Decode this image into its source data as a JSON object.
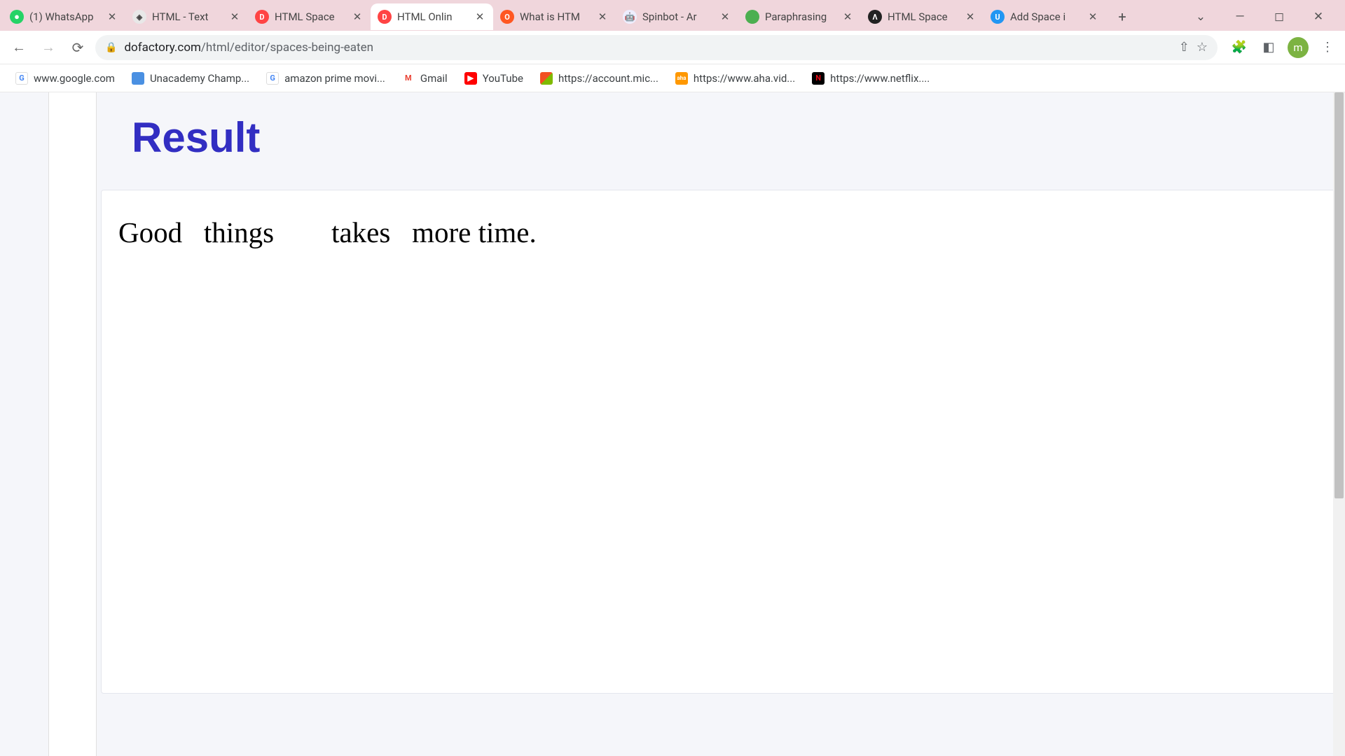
{
  "tabs": [
    {
      "title": "(1) WhatsApp",
      "favicon_bg": "#25d366",
      "favicon_text": "",
      "active": false
    },
    {
      "title": "HTML - Text",
      "favicon_bg": "#4a4a4a",
      "favicon_text": "◆",
      "active": false
    },
    {
      "title": "HTML Space",
      "favicon_bg": "#ff4444",
      "favicon_text": "D",
      "active": false
    },
    {
      "title": "HTML Onlin",
      "favicon_bg": "#ff4444",
      "favicon_text": "D",
      "active": true
    },
    {
      "title": "What is HTM",
      "favicon_bg": "#ff5722",
      "favicon_text": "O",
      "active": false
    },
    {
      "title": "Spinbot - Ar",
      "favicon_bg": "#5c6bc0",
      "favicon_text": "🤖",
      "active": false
    },
    {
      "title": "Paraphrasing",
      "favicon_bg": "#4caf50",
      "favicon_text": "",
      "active": false
    },
    {
      "title": "HTML Space",
      "favicon_bg": "#222222",
      "favicon_text": "Λ",
      "active": false
    },
    {
      "title": "Add Space i",
      "favicon_bg": "#2196f3",
      "favicon_text": "U",
      "active": false
    }
  ],
  "url": {
    "domain": "dofactory.com",
    "path": "/html/editor/spaces-being-eaten"
  },
  "avatar_letter": "m",
  "bookmarks": [
    {
      "text": "www.google.com",
      "favicon_bg": "#ffffff",
      "favicon_text": "G",
      "text_color": "#4285f4"
    },
    {
      "text": "Unacademy Champ...",
      "favicon_bg": "#4a90e2",
      "favicon_text": ""
    },
    {
      "text": "amazon prime movi...",
      "favicon_bg": "#ffffff",
      "favicon_text": "G",
      "text_color": "#4285f4"
    },
    {
      "text": "Gmail",
      "favicon_bg": "#ea4335",
      "favicon_text": "M"
    },
    {
      "text": "YouTube",
      "favicon_bg": "#ff0000",
      "favicon_text": "▶"
    },
    {
      "text": "https://account.mic...",
      "favicon_bg": "#00a4ef",
      "favicon_text": "⊞"
    },
    {
      "text": "https://www.aha.vid...",
      "favicon_bg": "#ff9800",
      "favicon_text": "aha"
    },
    {
      "text": "https://www.netflix....",
      "favicon_bg": "#e50914",
      "favicon_text": "N"
    }
  ],
  "page": {
    "result_title": "Result",
    "result_text": "Good   things        takes   more time."
  }
}
